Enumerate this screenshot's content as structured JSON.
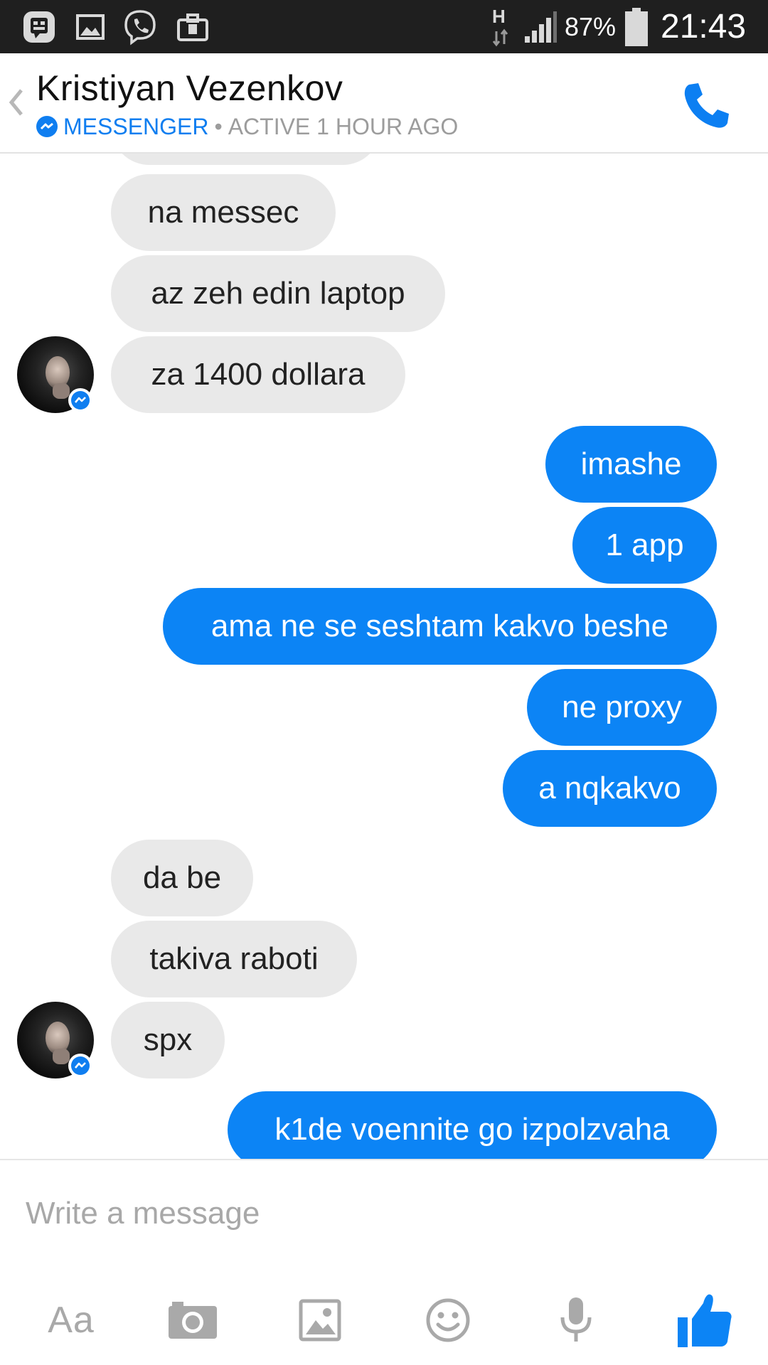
{
  "status_bar": {
    "network_type": "H",
    "battery_percent": "87%",
    "time": "21:43",
    "notification_icons": [
      "bbm-icon",
      "gallery-icon",
      "viber-icon",
      "briefcase-icon"
    ]
  },
  "header": {
    "contact_name": "Kristiyan Vezenkov",
    "platform": "MESSENGER",
    "separator": "•",
    "active_status": "ACTIVE 1 HOUR AGO",
    "accent_color": "#0f7ef0"
  },
  "messages": [
    {
      "direction": "incoming",
      "text": ""
    },
    {
      "direction": "incoming",
      "text": "na messec"
    },
    {
      "direction": "incoming",
      "text": "az zeh edin laptop"
    },
    {
      "direction": "incoming",
      "text": "za 1400 dollara"
    },
    {
      "direction": "outgoing",
      "text": "imashe"
    },
    {
      "direction": "outgoing",
      "text": "1 app"
    },
    {
      "direction": "outgoing",
      "text": "ama ne se seshtam kakvo beshe"
    },
    {
      "direction": "outgoing",
      "text": "ne proxy"
    },
    {
      "direction": "outgoing",
      "text": "a nqkakvo"
    },
    {
      "direction": "incoming",
      "text": "da be"
    },
    {
      "direction": "incoming",
      "text": "takiva raboti"
    },
    {
      "direction": "incoming",
      "text": "spx"
    },
    {
      "direction": "outgoing",
      "text": "k1de voennite go izpolzvaha"
    }
  ],
  "colors": {
    "outgoing_bubble": "#0c84f5",
    "incoming_bubble": "#e9e9e9",
    "toolbar_icon": "#a9a9a9"
  },
  "composer": {
    "placeholder": "Write a message",
    "value": "",
    "toolbar": {
      "text_format_label": "Aa",
      "icons": [
        "camera-icon",
        "image-icon",
        "emoji-icon",
        "microphone-icon",
        "thumbs-up-icon"
      ]
    }
  }
}
